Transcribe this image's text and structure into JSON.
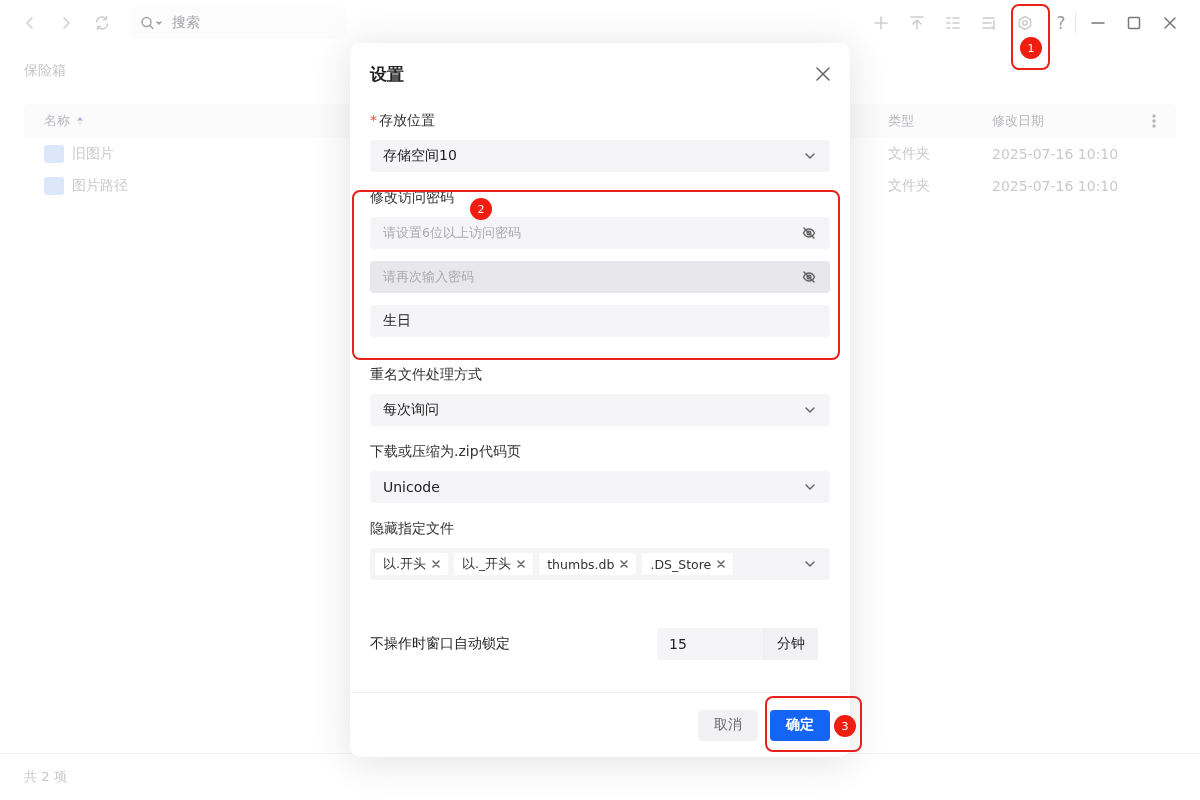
{
  "toolbar": {
    "search_placeholder": "搜索",
    "help": "?"
  },
  "breadcrumb": "保险箱",
  "table": {
    "columns": [
      {
        "label": "名称",
        "sorted": true
      },
      {
        "label": "类型"
      },
      {
        "label": "修改日期"
      }
    ],
    "rows": [
      {
        "name": "旧图片",
        "type": "文件夹",
        "modified": "2025-07-16 10:10"
      },
      {
        "name": "图片路径",
        "type": "文件夹",
        "modified": "2025-07-16 10:10"
      }
    ]
  },
  "status_bar": "共 2 项",
  "dialog": {
    "title": "设置",
    "fields": [
      {
        "kind": "select",
        "label": "存放位置",
        "required_mark": "*",
        "value": "存储空间10"
      },
      {
        "kind": "group",
        "label": "修改访问密码",
        "inputs": [
          {
            "kind": "password",
            "placeholder": "请设置6位以上访问密码",
            "hovered": false
          },
          {
            "kind": "password",
            "placeholder": "请再次输入密码",
            "hovered": true
          },
          {
            "kind": "text",
            "value": "生日",
            "hovered": false
          }
        ]
      },
      {
        "kind": "select",
        "label": "重名文件处理方式",
        "value": "每次询问"
      },
      {
        "kind": "select",
        "label": "下载或压缩为.zip代码页",
        "value": "Unicode"
      },
      {
        "kind": "tags",
        "label": "隐藏指定文件",
        "tags": [
          "以.开头",
          "以._开头",
          "thumbs.db",
          ".DS_Store"
        ]
      },
      {
        "kind": "number",
        "label": "不操作时窗口自动锁定",
        "value": "15",
        "unit": "分钟"
      }
    ],
    "buttons": [
      {
        "label": "取消",
        "primary": false
      },
      {
        "label": "确定",
        "primary": true
      }
    ]
  },
  "annotations": [
    {
      "label": "1"
    },
    {
      "label": "2"
    },
    {
      "label": "3"
    }
  ]
}
